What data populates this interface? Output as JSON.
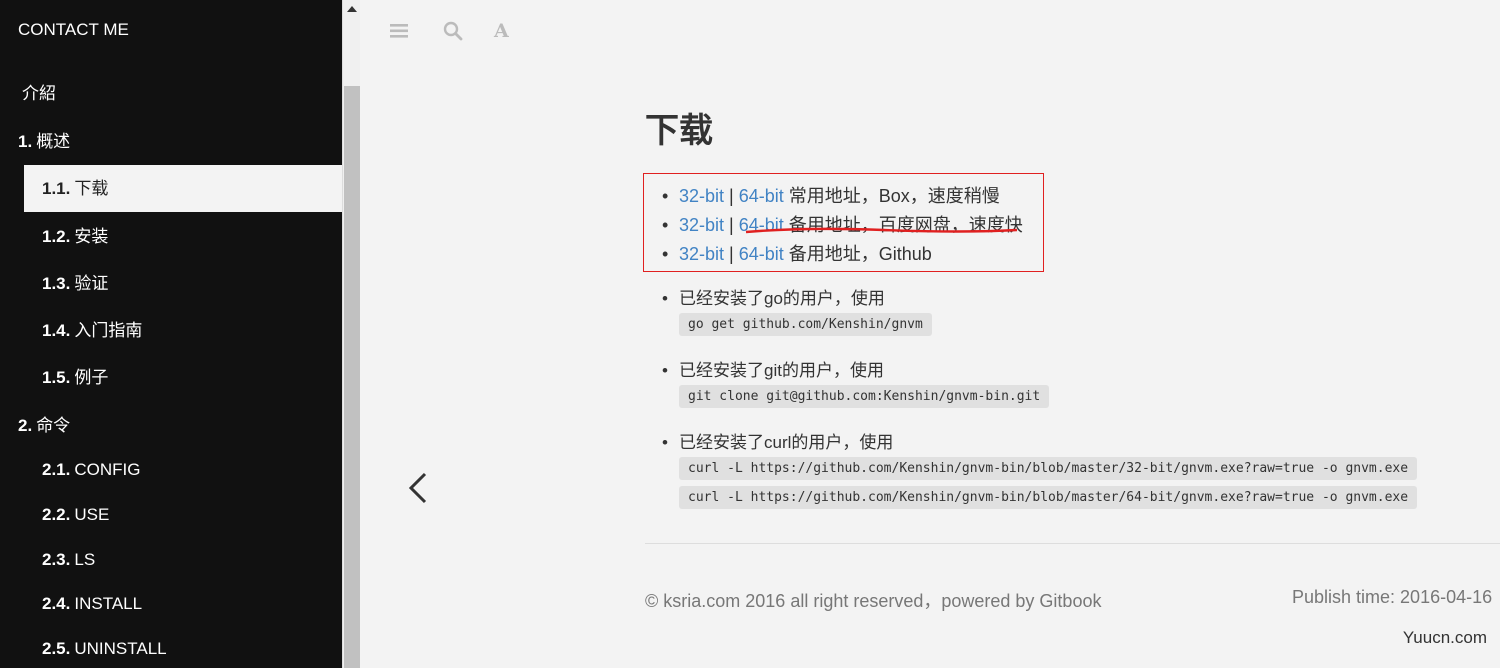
{
  "sidebar": {
    "title": "CONTACT ME",
    "items": [
      {
        "num": "",
        "label": "介紹"
      },
      {
        "num": "1.",
        "label": "概述"
      },
      {
        "num": "1.1.",
        "label": "下载"
      },
      {
        "num": "1.2.",
        "label": "安装"
      },
      {
        "num": "1.3.",
        "label": "验证"
      },
      {
        "num": "1.4.",
        "label": "入门指南"
      },
      {
        "num": "1.5.",
        "label": "例子"
      },
      {
        "num": "2.",
        "label": "命令"
      },
      {
        "num": "2.1.",
        "label": "CONFIG"
      },
      {
        "num": "2.2.",
        "label": "USE"
      },
      {
        "num": "2.3.",
        "label": "LS"
      },
      {
        "num": "2.4.",
        "label": "INSTALL"
      },
      {
        "num": "2.5.",
        "label": "UNINSTALL"
      }
    ]
  },
  "toolbar": {
    "menu_icon": "menu-icon",
    "search_icon": "search-icon",
    "font_label": "A"
  },
  "page": {
    "title": "下载",
    "downloads": [
      {
        "link32": "32-bit",
        "sep": " | ",
        "link64": "64-bit",
        "desc": " 常用地址，Box，速度稍慢"
      },
      {
        "link32": "32-bit",
        "sep": " | ",
        "link64": "64-bit",
        "desc": " 备用地址，百度网盘，速度快"
      },
      {
        "link32": "32-bit",
        "sep": " | ",
        "link64": "64-bit",
        "desc": " 备用地址，Github"
      }
    ],
    "instructions": [
      {
        "text": "已经安装了go的用户，使用",
        "code": [
          "go get github.com/Kenshin/gnvm"
        ]
      },
      {
        "text": "已经安装了git的用户，使用",
        "code": [
          "git clone git@github.com:Kenshin/gnvm-bin.git"
        ]
      },
      {
        "text": "已经安装了curl的用户，使用",
        "code": [
          "curl -L https://github.com/Kenshin/gnvm-bin/blob/master/32-bit/gnvm.exe?raw=true -o gnvm.exe",
          "curl -L https://github.com/Kenshin/gnvm-bin/blob/master/64-bit/gnvm.exe?raw=true -o gnvm.exe"
        ]
      }
    ]
  },
  "footer": {
    "copyright": "© ksria.com 2016 all right reserved，powered by Gitbook",
    "publish": "Publish time: 2016-04-16"
  },
  "watermark": "Yuucn.com",
  "colors": {
    "link": "#4183c4",
    "highlight_border": "#e02020",
    "sidebar_bg": "#111111",
    "page_bg": "#f3f3f3"
  }
}
